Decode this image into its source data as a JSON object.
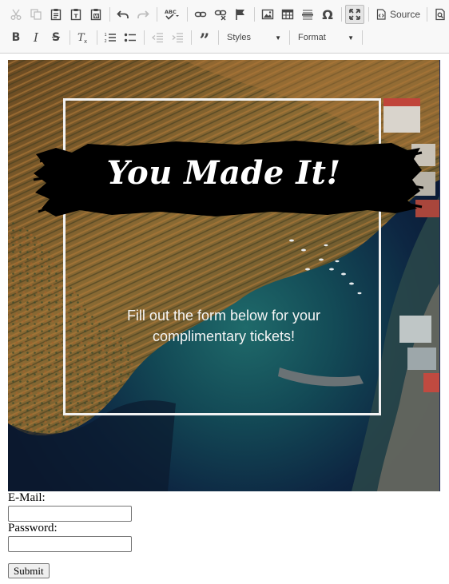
{
  "toolbar": {
    "source_label": "Source",
    "styles_label": "Styles",
    "format_label": "Format",
    "accent": "#474747"
  },
  "banner": {
    "headline": "You Made It!",
    "subtext": "Fill out the form below for your complimentary tickets!"
  },
  "form": {
    "email_label": "E-Mail:",
    "email_value": "",
    "password_label": "Password:",
    "password_value": "",
    "submit_label": "Submit"
  }
}
